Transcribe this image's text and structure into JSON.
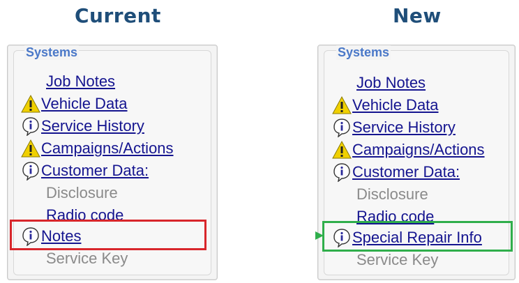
{
  "headings": {
    "current": "Current",
    "new": "New"
  },
  "panels": {
    "current": {
      "section_title": "Systems",
      "items": [
        {
          "label": "Job Notes",
          "icon": "none",
          "state": "link"
        },
        {
          "label": "Vehicle Data",
          "icon": "warning-icon",
          "state": "link"
        },
        {
          "label": "Service History",
          "icon": "info-icon",
          "state": "link"
        },
        {
          "label": "Campaigns/Actions",
          "icon": "warning-icon",
          "state": "link"
        },
        {
          "label": "Customer Data:",
          "icon": "info-icon",
          "state": "link"
        },
        {
          "label": "Disclosure",
          "icon": "none",
          "state": "disabled"
        },
        {
          "label": "Radio code",
          "icon": "none",
          "state": "link-plain"
        },
        {
          "label": "Notes",
          "icon": "info-icon",
          "state": "link"
        },
        {
          "label": "Service Key",
          "icon": "none",
          "state": "disabled"
        }
      ]
    },
    "new": {
      "section_title": "Systems",
      "items": [
        {
          "label": "Job Notes",
          "icon": "none",
          "state": "link"
        },
        {
          "label": "Vehicle Data",
          "icon": "warning-icon",
          "state": "link"
        },
        {
          "label": "Service History",
          "icon": "info-icon",
          "state": "link"
        },
        {
          "label": "Campaigns/Actions",
          "icon": "warning-icon",
          "state": "link"
        },
        {
          "label": "Customer Data:",
          "icon": "info-icon",
          "state": "link"
        },
        {
          "label": "Disclosure",
          "icon": "none",
          "state": "disabled"
        },
        {
          "label": "Radio code",
          "icon": "none",
          "state": "link"
        },
        {
          "label": "Special Repair Info",
          "icon": "info-icon",
          "state": "link"
        },
        {
          "label": "Service Key",
          "icon": "none",
          "state": "disabled"
        }
      ]
    }
  },
  "colors": {
    "heading": "#1f4e79",
    "section_title": "#4a78c8",
    "link": "#14148f",
    "disabled": "#8a8a8a",
    "highlight_current": "#d8262b",
    "highlight_new": "#2fae4b"
  }
}
